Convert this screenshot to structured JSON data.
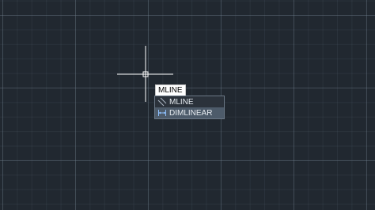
{
  "command_input": {
    "typed": "MLINE"
  },
  "autocomplete": {
    "items": [
      {
        "label": "MLINE",
        "icon": "mline-icon"
      },
      {
        "label": "DIMLINEAR",
        "icon": "dimlinear-icon"
      }
    ],
    "active_index": 1
  },
  "colors": {
    "background": "#212830",
    "crosshair": "#ffffff",
    "list_highlight": "#4d5b6a"
  }
}
